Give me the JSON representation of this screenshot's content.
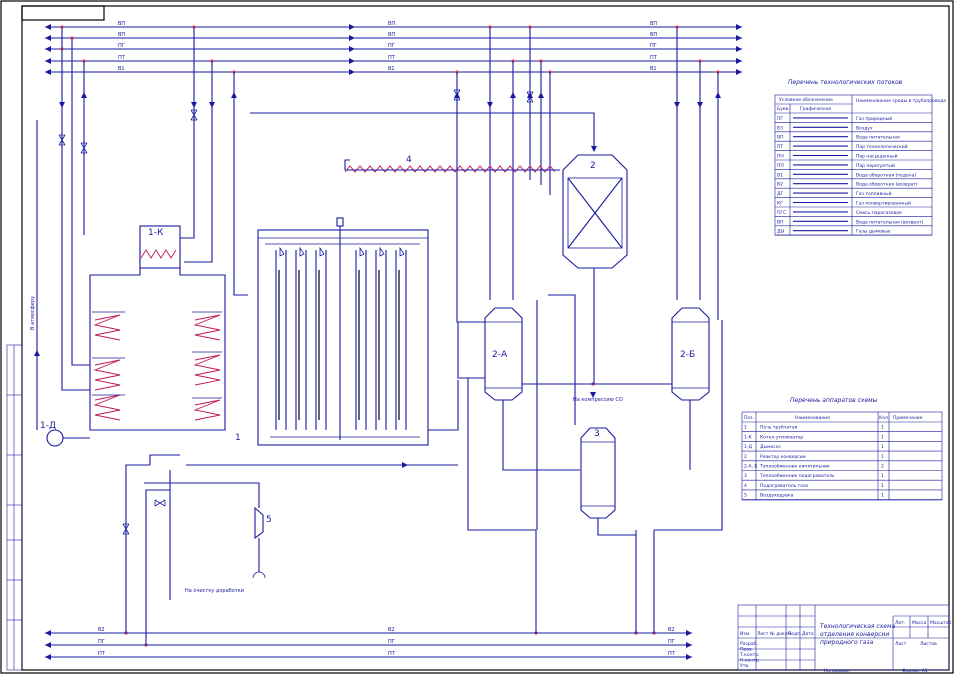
{
  "equipment": {
    "furnace_tag": "1",
    "boiler_tag": "1-К",
    "pump_tag": "1-Д",
    "converter2_tag": "2",
    "reactor_a_tag": "2-А",
    "reactor_b_tag": "2-Б",
    "vessel3_tag": "3",
    "preheater_tag": "4",
    "fan_tag": "5"
  },
  "annotations": {
    "to_atmosphere": "В атмосферу",
    "to_compression": "На компрессию СО",
    "to_clean": "На очистку\nдоработки"
  },
  "flows_legend": {
    "title": "Перечень технологических потоков",
    "header": [
      "Условное обозначение",
      "Наименование среды в трубопроводе"
    ],
    "subheader": [
      "Букв.",
      "Графическое"
    ],
    "rows": [
      [
        "ПГ",
        "Газ природный"
      ],
      [
        "ВЗ",
        "Воздух"
      ],
      [
        "ВП",
        "Вода питательная"
      ],
      [
        "ПТ",
        "Пар технологический"
      ],
      [
        "ПН",
        "Пар насыщенный"
      ],
      [
        "ПП",
        "Пар перегретый"
      ],
      [
        "В1",
        "Вода оборотная (подача)"
      ],
      [
        "В2",
        "Вода оборотная (возврат)"
      ],
      [
        "ДГ",
        "Газ топливный"
      ],
      [
        "КГ",
        "Газ конвертированный"
      ],
      [
        "ПГС",
        "Смесь парогазовая"
      ],
      [
        "ВП",
        "Вода питательная (возврат)"
      ],
      [
        "ДЫ",
        "Газы дымовые"
      ]
    ]
  },
  "equipment_list": {
    "title": "Перечень аппаратов схемы",
    "header": [
      "Поз.",
      "Наименование",
      "Кол.",
      "Примечание"
    ],
    "rows": [
      [
        "1",
        "Печь трубчатая",
        "1",
        ""
      ],
      [
        "1-К",
        "Котел-утилизатор",
        "1",
        ""
      ],
      [
        "1-Д",
        "Дымосос",
        "1",
        ""
      ],
      [
        "2",
        "Реактор конверсии",
        "1",
        ""
      ],
      [
        "2-А, Б",
        "Теплообменник кипятильник",
        "2",
        ""
      ],
      [
        "3",
        "Теплообменник подогреватель",
        "1",
        ""
      ],
      [
        "4",
        "Подогреватель газа",
        "1",
        ""
      ],
      [
        "5",
        "Воздуходувка",
        "1",
        ""
      ]
    ]
  },
  "title_block": {
    "doc_title": "Технологическая схема отделения конверсии природного газа",
    "roles": [
      "Изм.",
      "Лист",
      "№ докум.",
      "Подп.",
      "Дата",
      "Разраб.",
      "Пров.",
      "Т.контр.",
      "Н.контр.",
      "Утв."
    ],
    "stage_labels": [
      "Лит.",
      "Масса",
      "Масштаб"
    ],
    "sheet_label": "Лист",
    "sheets_label": "Листов",
    "copied": "Копировал",
    "format": "Формат А1"
  },
  "line_labels": {
    "top": [
      "ВП",
      "ВП",
      "ПГ",
      "ПТ",
      "В1"
    ],
    "bottom": [
      "В2",
      "ПГ",
      "ПТ"
    ]
  }
}
